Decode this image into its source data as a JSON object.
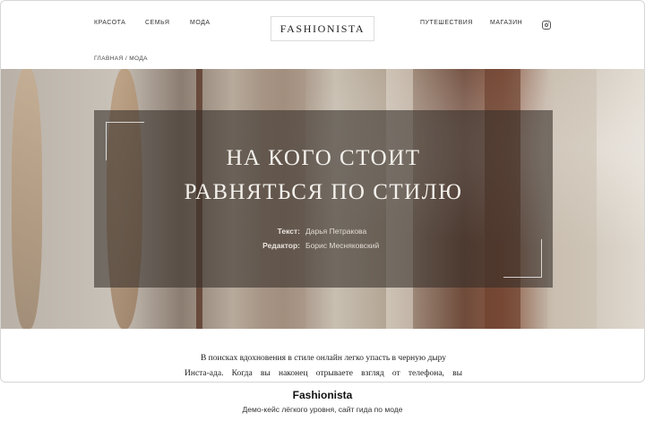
{
  "header": {
    "nav_left": [
      "КРАСОТА",
      "СЕМЬЯ",
      "МОДА"
    ],
    "logo": "FASHIONISTA",
    "nav_right": [
      "ПУТЕШЕСТВИЯ",
      "МАГАЗИН"
    ],
    "social_icon": "instagram-icon"
  },
  "breadcrumb": "ГЛАВНАЯ / МОДА",
  "hero": {
    "title_line1": "НА КОГО СТОИТ",
    "title_line2": "РАВНЯТЬСЯ ПО СТИЛЮ",
    "author_label": "Текст:",
    "author_name": "Дарья Петракова",
    "editor_label": "Редактор:",
    "editor_name": "Борис Месняковский"
  },
  "article": {
    "line1": "В поисках вдохновения в стиле онлайн легко упасть в черную дыру",
    "line2": "Инста-ада. Когда вы наконец отрываете взгляд от телефона, вы"
  },
  "caption": {
    "title": "Fashionista",
    "subtitle": "Демо-кейс лёгкого уровня, сайт гида по моде"
  }
}
